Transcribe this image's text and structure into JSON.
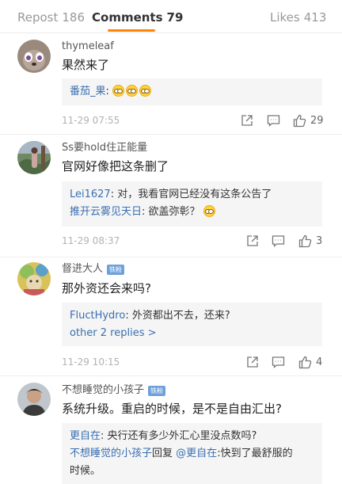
{
  "tabs": {
    "repost": {
      "label": "Repost",
      "count": "186"
    },
    "comments": {
      "label": "Comments",
      "count": "79"
    },
    "likes": {
      "label": "Likes",
      "count": "413"
    }
  },
  "colors": {
    "accent": "#ff8200",
    "link": "#3a6fb0",
    "badge": "#6ea1d9"
  },
  "comments": [
    {
      "username": "thymeleaf",
      "text": "果然来了",
      "replies": [
        {
          "author": "番茄_果",
          "text": ": ",
          "emoji": [
            "sunglasses-emoji",
            "sunglasses-emoji",
            "sunglasses-emoji"
          ]
        }
      ],
      "time": "11-29 07:55",
      "likes": "29"
    },
    {
      "username": "Ss要hold住正能量",
      "text": "官网好像把这条删了",
      "replies": [
        {
          "author": "Lei1627",
          "text": ": 对，我看官网已经没有这条公告了"
        },
        {
          "author": "推开云雾见天日",
          "text": ": 欲盖弥彰？",
          "emoji": [
            "grin-emoji"
          ]
        }
      ],
      "time": "11-29 08:37",
      "likes": "3"
    },
    {
      "username": "督进大人",
      "badge": "铁粉",
      "text": "那外资还会来吗?",
      "replies": [
        {
          "author": "FluctHydro",
          "text": ": 外资都出不去，还来?"
        }
      ],
      "more_replies": "other 2 replies >",
      "time": "11-29 10:15",
      "likes": "4"
    },
    {
      "username": "不想睡觉的小孩子",
      "badge": "铁粉",
      "text": "系统升级。重启的时候，是不是自由汇出?",
      "replies": [
        {
          "author": "更自在",
          "text": ": 央行还有多少外汇心里没点数吗?"
        },
        {
          "author": "不想睡觉的小孩子",
          "reply_word": "回复",
          "target": "@更自在",
          "text": ":快到了最舒服的",
          "text2": "时候。"
        }
      ]
    }
  ]
}
